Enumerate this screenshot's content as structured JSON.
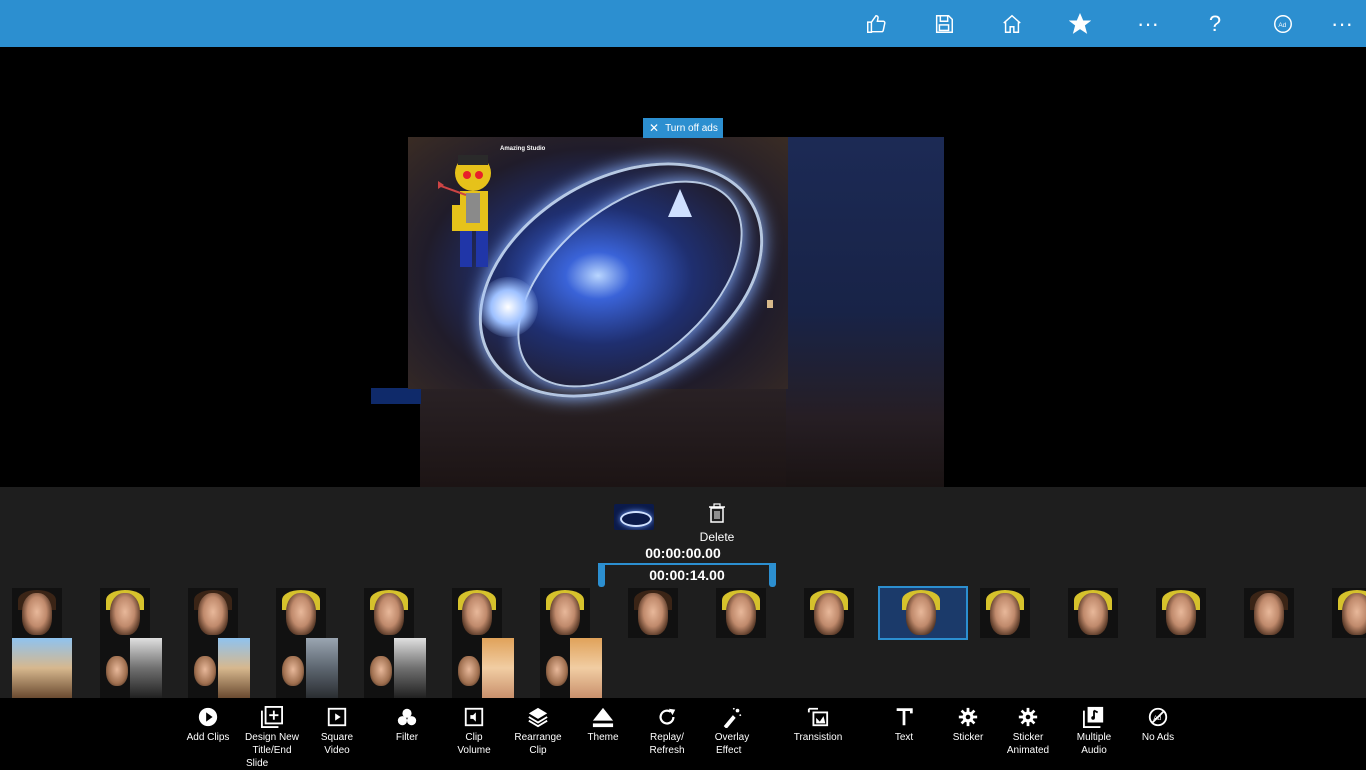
{
  "topbar": {
    "icons": [
      "thumbs-up-icon",
      "save-icon",
      "home-icon",
      "star-icon",
      "more-icon",
      "help-icon",
      "account-icon",
      "more-icon"
    ],
    "more_label": "···",
    "help_label": "?"
  },
  "stage": {
    "ads_button": "Turn off ads",
    "ads_close": "✕",
    "watermark": "Amazing Studio"
  },
  "editor": {
    "delete_label": "Delete",
    "start_time": "00:00:00.00",
    "end_time": "00:00:14.00"
  },
  "toolbar": {
    "tools": [
      {
        "line1": "Add Clips",
        "line2": "",
        "line3": ""
      },
      {
        "line1": "Design New",
        "line2": "Title/End",
        "line3": "Slide"
      },
      {
        "line1": "Square",
        "line2": "Video",
        "line3": ""
      },
      {
        "line1": "Filter",
        "line2": "",
        "line3": ""
      },
      {
        "line1": "Clip",
        "line2": "Volume",
        "line3": ""
      },
      {
        "line1": "Rearrange",
        "line2": "Clip",
        "line3": ""
      },
      {
        "line1": "Theme",
        "line2": "",
        "line3": ""
      },
      {
        "line1": "Replay/",
        "line2": "Refresh",
        "line3": ""
      },
      {
        "line1": "Overlay",
        "line2": "Effect",
        "line3": ""
      },
      {
        "line1": "Transistion",
        "line2": "",
        "line3": ""
      },
      {
        "line1": "Text",
        "line2": "",
        "line3": ""
      },
      {
        "line1": "Sticker",
        "line2": "",
        "line3": ""
      },
      {
        "line1": "Sticker",
        "line2": "Animated",
        "line3": ""
      },
      {
        "line1": "Multiple",
        "line2": "Audio",
        "line3": ""
      },
      {
        "line1": "No Ads",
        "line2": "",
        "line3": ""
      }
    ]
  },
  "colors": {
    "accent": "#2c8fd0",
    "panel": "#1e1e1e"
  }
}
